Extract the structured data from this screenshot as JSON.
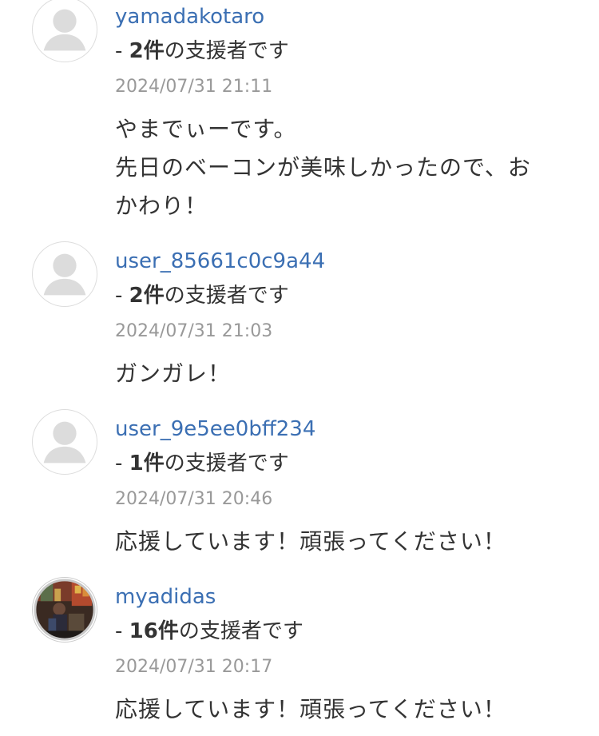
{
  "comments": [
    {
      "username": "yamadakotaro",
      "supporter_prefix": "- ",
      "supporter_count": "2件",
      "supporter_suffix": "の支援者です",
      "date": "2024/07/31 21:11",
      "body_lines": [
        "やまでぃーです。",
        "先日のベーコンが美味しかったので、お",
        "かわり！"
      ],
      "avatar": "default-user-icon"
    },
    {
      "username": "user_85661c0c9a44",
      "supporter_prefix": "- ",
      "supporter_count": "2件",
      "supporter_suffix": "の支援者です",
      "date": "2024/07/31 21:03",
      "body_lines": [
        "ガンガレ！"
      ],
      "avatar": "default-user-icon"
    },
    {
      "username": "user_9e5ee0bff234",
      "supporter_prefix": "- ",
      "supporter_count": "1件",
      "supporter_suffix": "の支援者です",
      "date": "2024/07/31 20:46",
      "body_lines": [
        "応援しています！頑張ってください！"
      ],
      "avatar": "default-user-icon"
    },
    {
      "username": "myadidas",
      "supporter_prefix": "- ",
      "supporter_count": "16件",
      "supporter_suffix": "の支援者です",
      "date": "2024/07/31 20:17",
      "body_lines": [
        "応援しています！頑張ってください！"
      ],
      "avatar": "user-photo"
    }
  ],
  "colors": {
    "username_link": "#3b6fb3",
    "date_text": "#999999",
    "body_text": "#333333",
    "avatar_placeholder": "#dcdcdc"
  }
}
